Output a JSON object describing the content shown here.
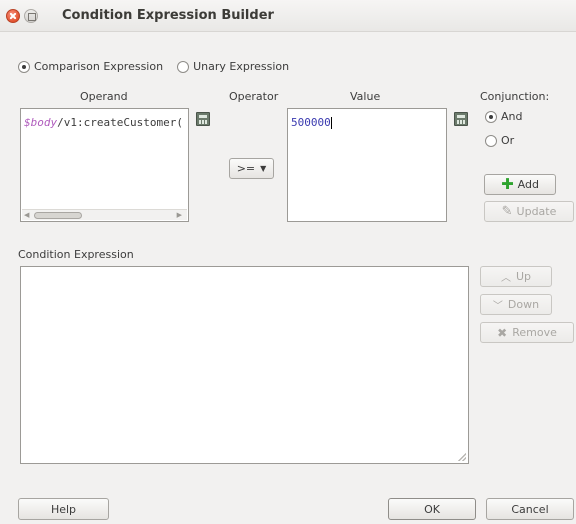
{
  "window": {
    "title": "Condition Expression Builder"
  },
  "expression_type": {
    "options": [
      "Comparison Expression",
      "Unary Expression"
    ],
    "selected": "Comparison Expression"
  },
  "columns": {
    "operand": "Operand",
    "operator": "Operator",
    "value": "Value",
    "conjunction": "Conjunction:"
  },
  "operand": {
    "prefix": "$body",
    "text": "/v1:createCustomer("
  },
  "operator": {
    "selected": ">="
  },
  "value": {
    "text": "500000"
  },
  "conjunction": {
    "options": [
      "And",
      "Or"
    ],
    "selected": "And"
  },
  "buttons": {
    "add": "Add",
    "update": "Update",
    "up": "Up",
    "down": "Down",
    "remove": "Remove",
    "help": "Help",
    "ok": "OK",
    "cancel": "Cancel"
  },
  "condition_expression": {
    "label": "Condition Expression",
    "text": ""
  }
}
